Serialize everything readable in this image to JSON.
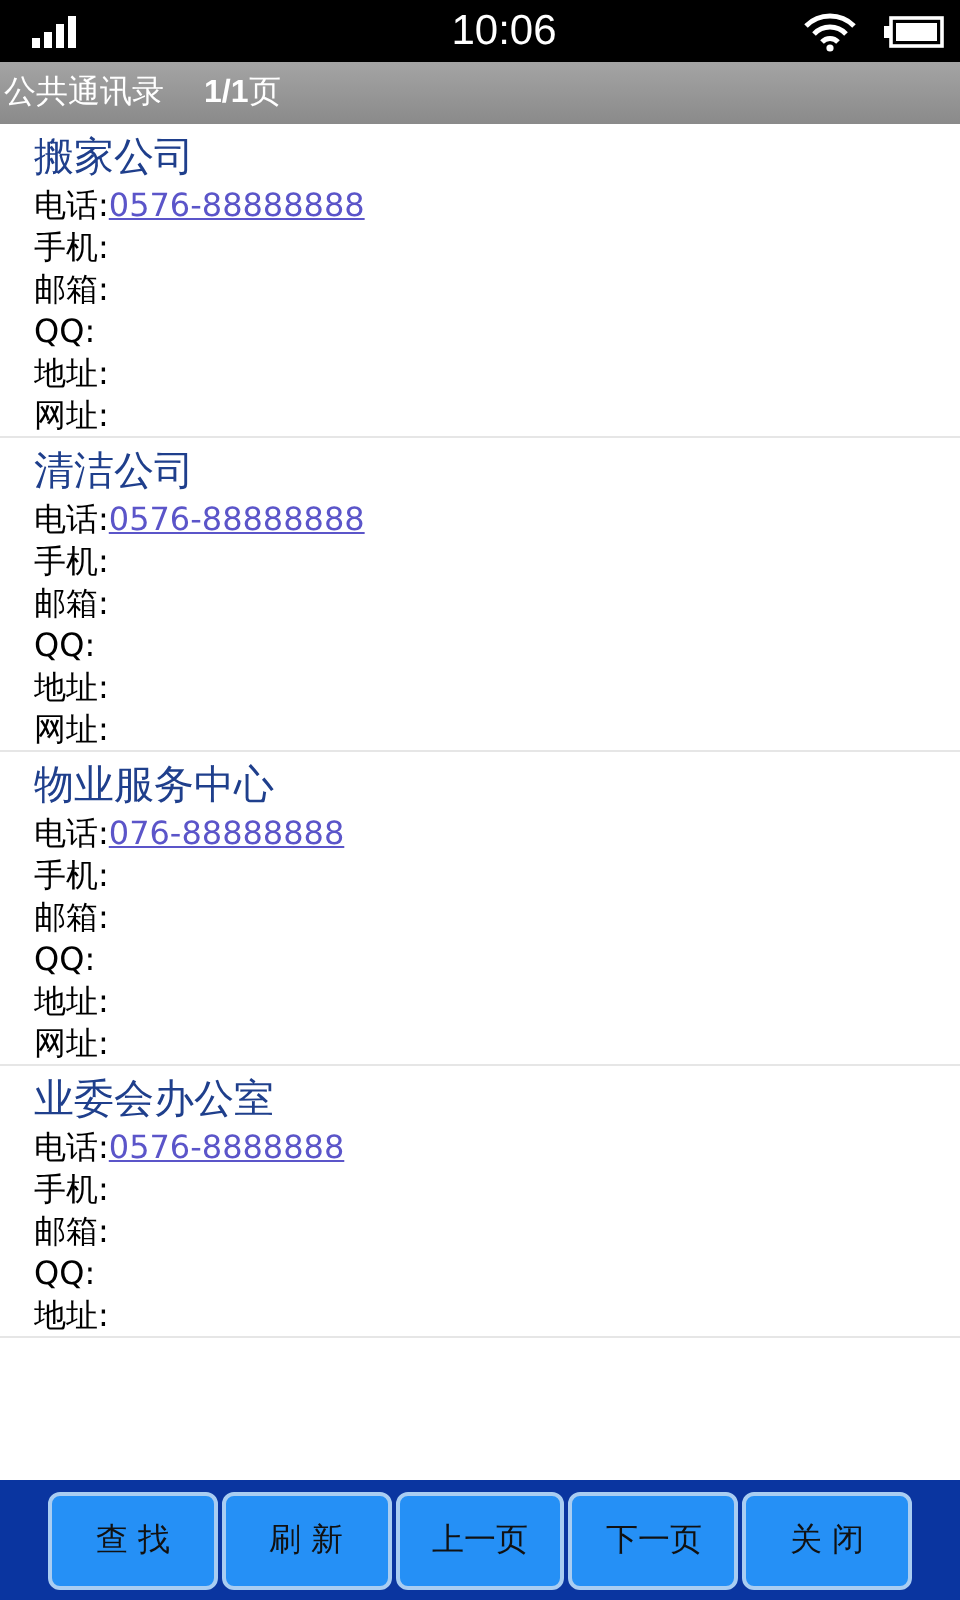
{
  "status_bar": {
    "time": "10:06"
  },
  "header": {
    "title": "公共通讯录",
    "page": "1/1",
    "page_suffix": "页"
  },
  "contacts": [
    {
      "name": "搬家公司",
      "fields": [
        {
          "label": "电话:",
          "value": "0576-88888888"
        },
        {
          "label": "手机:"
        },
        {
          "label": "邮箱:"
        },
        {
          "label": "QQ:"
        },
        {
          "label": "地址:"
        },
        {
          "label": "网址:"
        }
      ]
    },
    {
      "name": "清洁公司",
      "fields": [
        {
          "label": "电话:",
          "value": "0576-88888888"
        },
        {
          "label": "手机:"
        },
        {
          "label": "邮箱:"
        },
        {
          "label": "QQ:"
        },
        {
          "label": "地址:"
        },
        {
          "label": "网址:"
        }
      ]
    },
    {
      "name": "物业服务中心",
      "fields": [
        {
          "label": "电话:",
          "value": "076-88888888"
        },
        {
          "label": "手机:"
        },
        {
          "label": "邮箱:"
        },
        {
          "label": "QQ:"
        },
        {
          "label": "地址:"
        },
        {
          "label": "网址:"
        }
      ]
    },
    {
      "name": "业委会办公室",
      "fields": [
        {
          "label": "电话:",
          "value": "0576-8888888"
        },
        {
          "label": "手机:"
        },
        {
          "label": "邮箱:"
        },
        {
          "label": "QQ:"
        },
        {
          "label": "地址:"
        }
      ]
    }
  ],
  "buttons": [
    "查 找",
    "刷 新",
    "上一页",
    "下一页",
    "关 闭"
  ]
}
